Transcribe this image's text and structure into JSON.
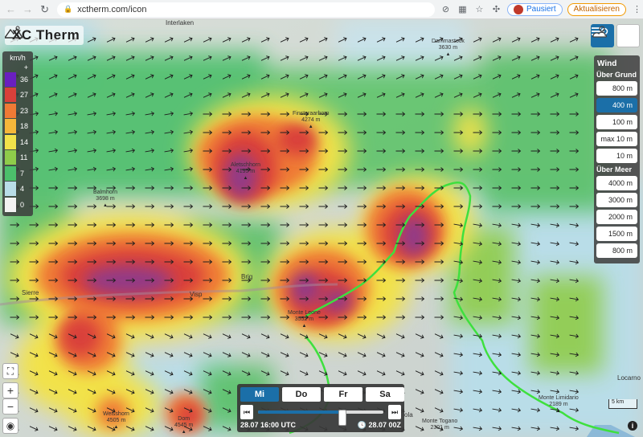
{
  "browser": {
    "url": "xctherm.com/icon",
    "profile_label": "Pausiert",
    "update_label": "Aktualisieren"
  },
  "app": {
    "title": "XC Therm"
  },
  "legend": {
    "unit": "km/h",
    "plus": "+",
    "items": [
      {
        "value": "36",
        "color": "#6a1fbf"
      },
      {
        "value": "27",
        "color": "#d9403a"
      },
      {
        "value": "23",
        "color": "#ef7a35"
      },
      {
        "value": "18",
        "color": "#f5b73a"
      },
      {
        "value": "14",
        "color": "#f2e24a"
      },
      {
        "value": "11",
        "color": "#8fcc4a"
      },
      {
        "value": "7",
        "color": "#4cbf6b"
      },
      {
        "value": "4",
        "color": "#b9dde8"
      },
      {
        "value": "0",
        "color": "#f2f2f2"
      }
    ]
  },
  "places": [
    {
      "name": "Interlaken",
      "elev": ""
    },
    {
      "name": "Dammastock",
      "elev": "3630 m"
    },
    {
      "name": "Finsteraarhorn",
      "elev": "4274 m"
    },
    {
      "name": "Aletschhorn",
      "elev": "4195 m"
    },
    {
      "name": "Balmhorn",
      "elev": "3698 m"
    },
    {
      "name": "Monte Leone",
      "elev": "3552 m"
    },
    {
      "name": "Weisshorn",
      "elev": "4505 m"
    },
    {
      "name": "Dom",
      "elev": "4545 m"
    },
    {
      "name": "Monte Togano",
      "elev": "2301 m"
    },
    {
      "name": "Monte Limidario",
      "elev": "2189 m"
    }
  ],
  "towns": {
    "sierre": "Sierre",
    "visp": "Visp",
    "brig": "Brig",
    "locarno": "Locarno",
    "ola": "ola"
  },
  "panel": {
    "title": "Wind",
    "ground_label": "Über Grund",
    "ground_levels": [
      "800 m",
      "400 m",
      "100 m",
      "max 10 m",
      "10 m"
    ],
    "active_level": "400 m",
    "sea_label": "Über Meer",
    "sea_levels": [
      "4000 m",
      "3000 m",
      "2000 m",
      "1500 m",
      "800 m"
    ]
  },
  "time": {
    "days": [
      "Mi",
      "Do",
      "Fr",
      "Sa"
    ],
    "active_day": "Mi",
    "current": "28.07 16:00 UTC",
    "local": "28.07 00Z",
    "position": 0.67
  },
  "scale_label": "5 km",
  "info_label": "i",
  "colors": {
    "accent": "#1b6fa8",
    "route": "#3ee03e"
  }
}
